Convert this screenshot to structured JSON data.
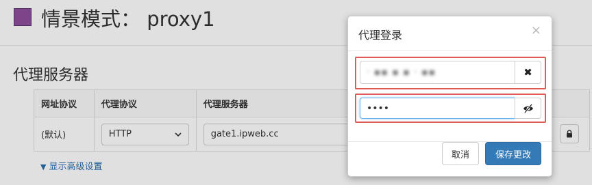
{
  "header": {
    "title": "情景模式： proxy1",
    "swatch_color": "#8e4f9e"
  },
  "section": {
    "title": "代理服务器"
  },
  "table": {
    "headers": [
      "网址协议",
      "代理协议",
      "代理服务器"
    ],
    "row": {
      "url_protocol": "(默认)",
      "proxy_protocol": "HTTP",
      "proxy_server": "gate1.ipweb.cc"
    }
  },
  "advanced": {
    "label": "显示高级设置"
  },
  "modal": {
    "title": "代理登录",
    "close_symbol": "×",
    "username_value": "·  ▪▪ ▪  ▪   ·  ▪▪",
    "clear_icon": "✖",
    "password_value": "••••",
    "cancel_label": "取消",
    "save_label": "保存更改"
  },
  "colors": {
    "highlight": "#e05a5a",
    "primary_button": "#337ab7",
    "link": "#2a6fb0"
  }
}
